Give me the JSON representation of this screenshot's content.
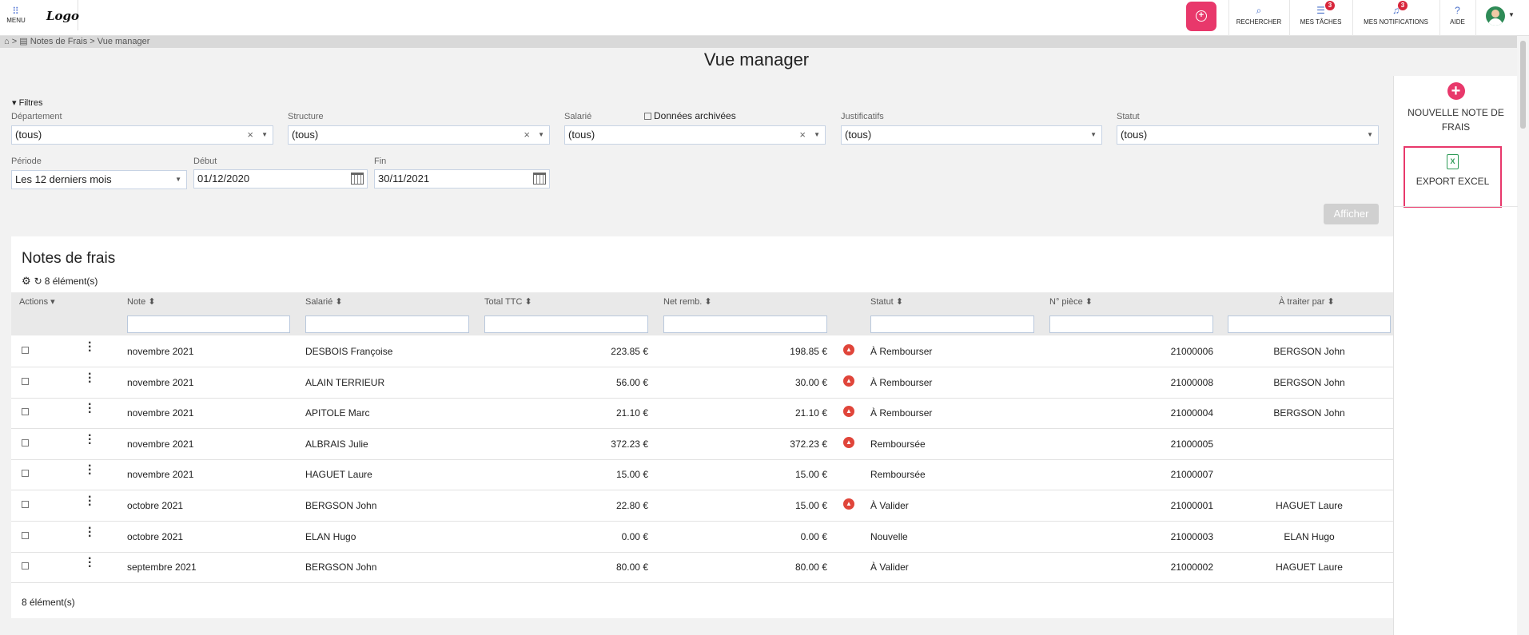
{
  "topbar": {
    "menu_label": "MENU",
    "logo_text": "Logo",
    "nav": [
      {
        "label": "RECHERCHER",
        "icon": "search-icon"
      },
      {
        "label": "MES TÂCHES",
        "icon": "tasks-icon",
        "badge": "3"
      },
      {
        "label": "MES NOTIFICATIONS",
        "icon": "bell-icon",
        "badge": "3"
      },
      {
        "label": "AIDE",
        "icon": "help-icon"
      }
    ]
  },
  "breadcrumb": {
    "separator": ">",
    "module": "Notes de Frais",
    "page": "Vue manager"
  },
  "page": {
    "title": "Vue manager"
  },
  "side_panel": {
    "new_label": "NOUVELLE NOTE DE FRAIS",
    "export_label": "EXPORT EXCEL"
  },
  "filters": {
    "toggle_label": "Filtres",
    "departement": {
      "label": "Département",
      "value": "(tous)"
    },
    "structure": {
      "label": "Structure",
      "value": "(tous)"
    },
    "salarie": {
      "label": "Salarié",
      "value": "(tous)"
    },
    "archived_label": "Données archivées",
    "justificatifs": {
      "label": "Justificatifs",
      "value": "(tous)"
    },
    "statut": {
      "label": "Statut",
      "value": "(tous)"
    },
    "periode": {
      "label": "Période",
      "value": "Les 12 derniers mois"
    },
    "debut": {
      "label": "Début",
      "value": "01/12/2020"
    },
    "fin": {
      "label": "Fin",
      "value": "30/11/2021"
    },
    "submit_label": "Afficher"
  },
  "grid": {
    "title": "Notes de frais",
    "count": "8 élément(s)",
    "columns": {
      "actions": "Actions",
      "note": "Note",
      "salarie": "Salarié",
      "total": "Total TTC",
      "net": "Net remb.",
      "statut": "Statut",
      "piece": "N° pièce",
      "traiter": "À traiter par"
    },
    "rows": [
      {
        "note": "novembre 2021",
        "salarie": "DESBOIS Françoise",
        "total": "223.85 €",
        "net": "198.85 €",
        "warn": true,
        "statut": "À Rembourser",
        "piece": "21000006",
        "traiter": "BERGSON John"
      },
      {
        "note": "novembre 2021",
        "salarie": "ALAIN TERRIEUR",
        "total": "56.00 €",
        "net": "30.00 €",
        "warn": true,
        "statut": "À Rembourser",
        "piece": "21000008",
        "traiter": "BERGSON John"
      },
      {
        "note": "novembre 2021",
        "salarie": "APITOLE Marc",
        "total": "21.10 €",
        "net": "21.10 €",
        "warn": true,
        "statut": "À Rembourser",
        "piece": "21000004",
        "traiter": "BERGSON John"
      },
      {
        "note": "novembre 2021",
        "salarie": "ALBRAIS Julie",
        "total": "372.23 €",
        "net": "372.23 €",
        "warn": true,
        "statut": "Remboursée",
        "piece": "21000005",
        "traiter": ""
      },
      {
        "note": "novembre 2021",
        "salarie": "HAGUET Laure",
        "total": "15.00 €",
        "net": "15.00 €",
        "warn": false,
        "statut": "Remboursée",
        "piece": "21000007",
        "traiter": ""
      },
      {
        "note": "octobre 2021",
        "salarie": "BERGSON John",
        "total": "22.80 €",
        "net": "15.00 €",
        "warn": true,
        "statut": "À Valider",
        "piece": "21000001",
        "traiter": "HAGUET Laure"
      },
      {
        "note": "octobre 2021",
        "salarie": "ELAN Hugo",
        "total": "0.00 €",
        "net": "0.00 €",
        "warn": false,
        "statut": "Nouvelle",
        "piece": "21000003",
        "traiter": "ELAN Hugo"
      },
      {
        "note": "septembre 2021",
        "salarie": "BERGSON John",
        "total": "80.00 €",
        "net": "80.00 €",
        "warn": false,
        "statut": "À Valider",
        "piece": "21000002",
        "traiter": "HAGUET Laure"
      }
    ],
    "footer_count": "8 élément(s)"
  },
  "colors": {
    "accent": "#e8386b",
    "badge": "#d8263b",
    "link": "#4a70c9",
    "warning": "#e0453a"
  }
}
